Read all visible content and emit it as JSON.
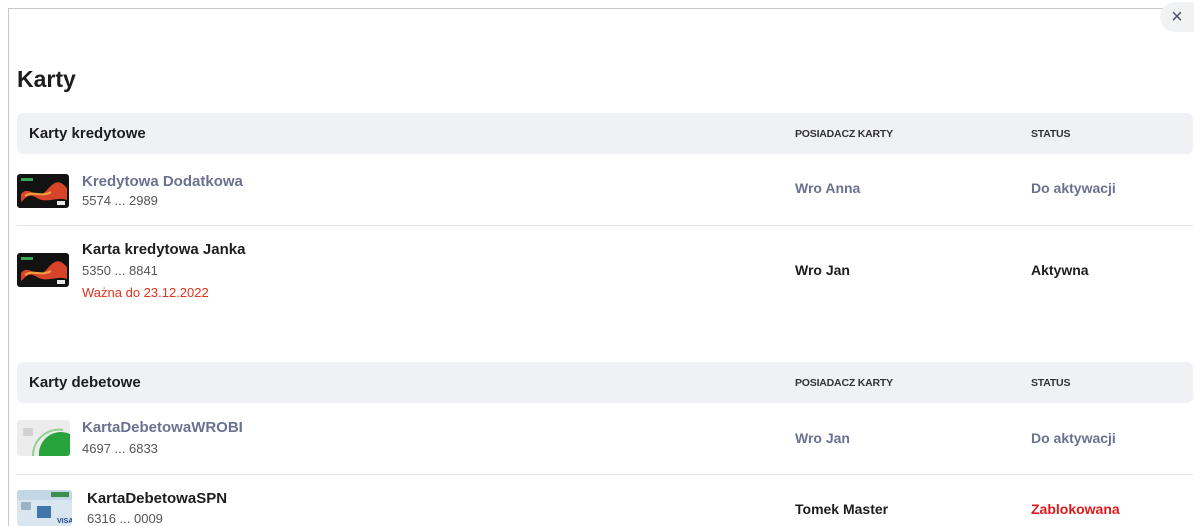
{
  "dialog": {
    "close_icon": "×"
  },
  "page": {
    "title": "Karty"
  },
  "columns": {
    "holder": "POSIADACZ KARTY",
    "status": "STATUS"
  },
  "credit": {
    "header": "Karty kredytowe",
    "cards": [
      {
        "name": "Kredytowa Dodatkowa",
        "number": "5574 ... 2989",
        "holder": "Wro Anna",
        "status": "Do aktywacji"
      },
      {
        "name": "Karta kredytowa Janka",
        "number": "5350 ... 8841",
        "valid": "Ważna do 23.12.2022",
        "holder": "Wro Jan",
        "status": "Aktywna"
      }
    ]
  },
  "debit": {
    "header": "Karty debetowe",
    "cards": [
      {
        "name": "KartaDebetowaWROBI",
        "number": "4697 ... 6833",
        "holder": "Wro Jan",
        "status": "Do aktywacji"
      },
      {
        "name": "KartaDebetowaSPN",
        "number": "6316 ... 0009",
        "holder": "Tomek Master",
        "status": "Zablokowana"
      }
    ]
  },
  "colors": {
    "muted": "#6b7190",
    "red": "#e0181b",
    "header_bg": "#f0f1f4"
  },
  "icons": {
    "credit_card": "credit-card-image",
    "debit_card_green": "debit-card-green-image",
    "debit_card_visa": "debit-card-visa-image"
  }
}
